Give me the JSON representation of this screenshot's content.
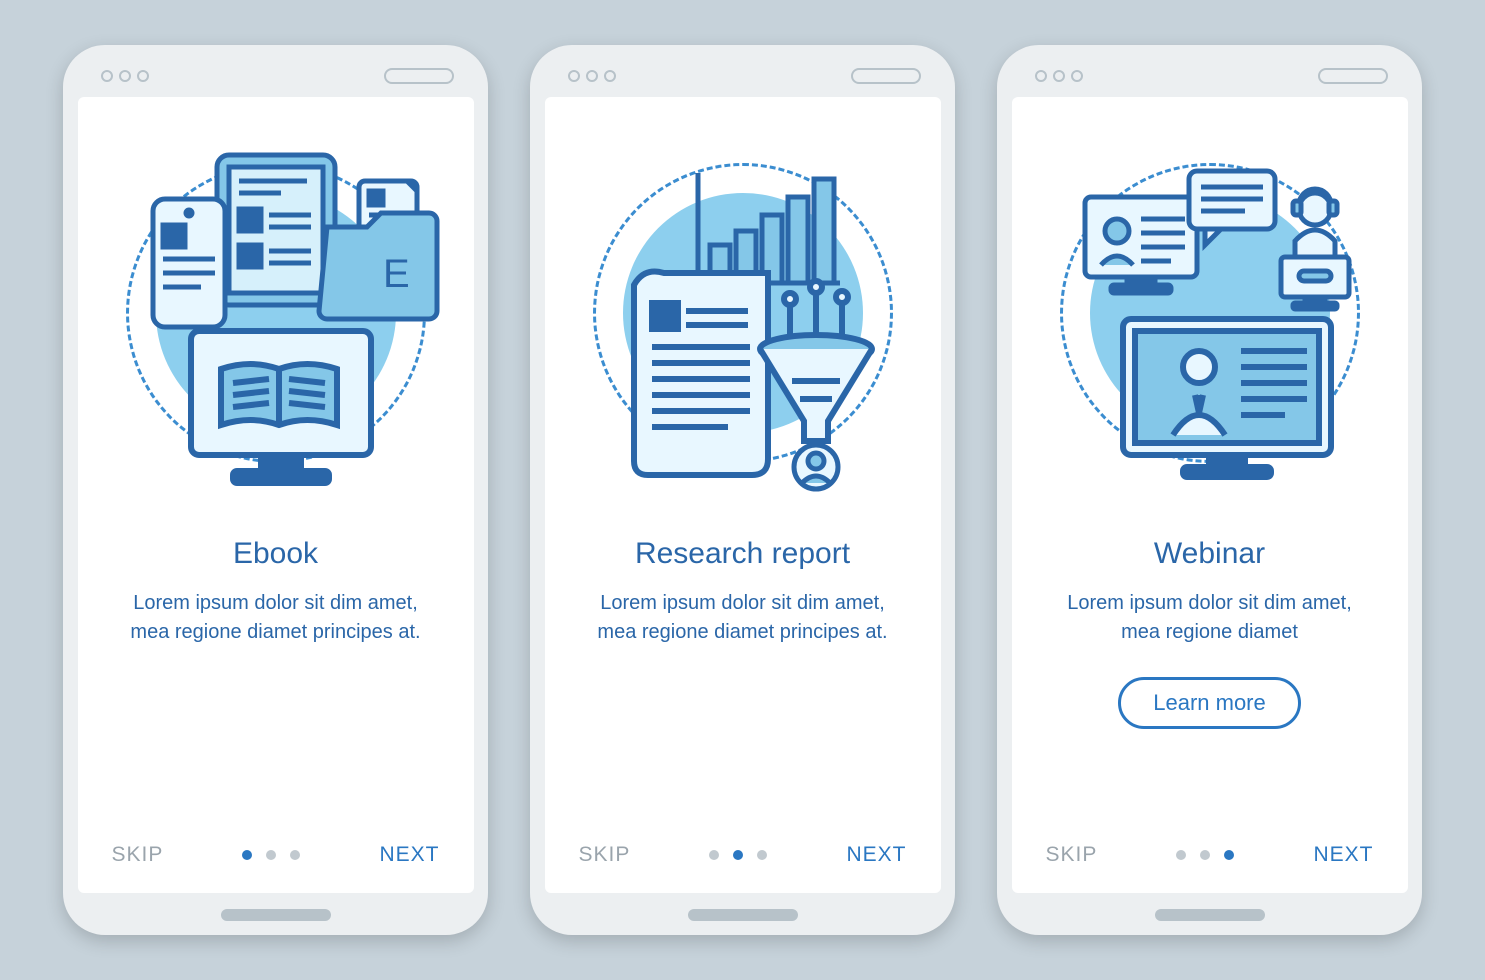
{
  "screens": [
    {
      "title": "Ebook",
      "desc": "Lorem ipsum dolor sit dim amet, mea regione diamet principes at.",
      "skip": "SKIP",
      "next": "NEXT",
      "folder_letter": "E",
      "activeDot": 0,
      "hasButton": false
    },
    {
      "title": "Research report",
      "desc": "Lorem ipsum dolor sit dim amet, mea regione diamet principes at.",
      "skip": "SKIP",
      "next": "NEXT",
      "activeDot": 1,
      "hasButton": false
    },
    {
      "title": "Webinar",
      "desc": "Lorem ipsum dolor sit dim amet, mea regione diamet",
      "skip": "SKIP",
      "next": "NEXT",
      "button": "Learn more",
      "activeDot": 2,
      "hasButton": true
    }
  ]
}
